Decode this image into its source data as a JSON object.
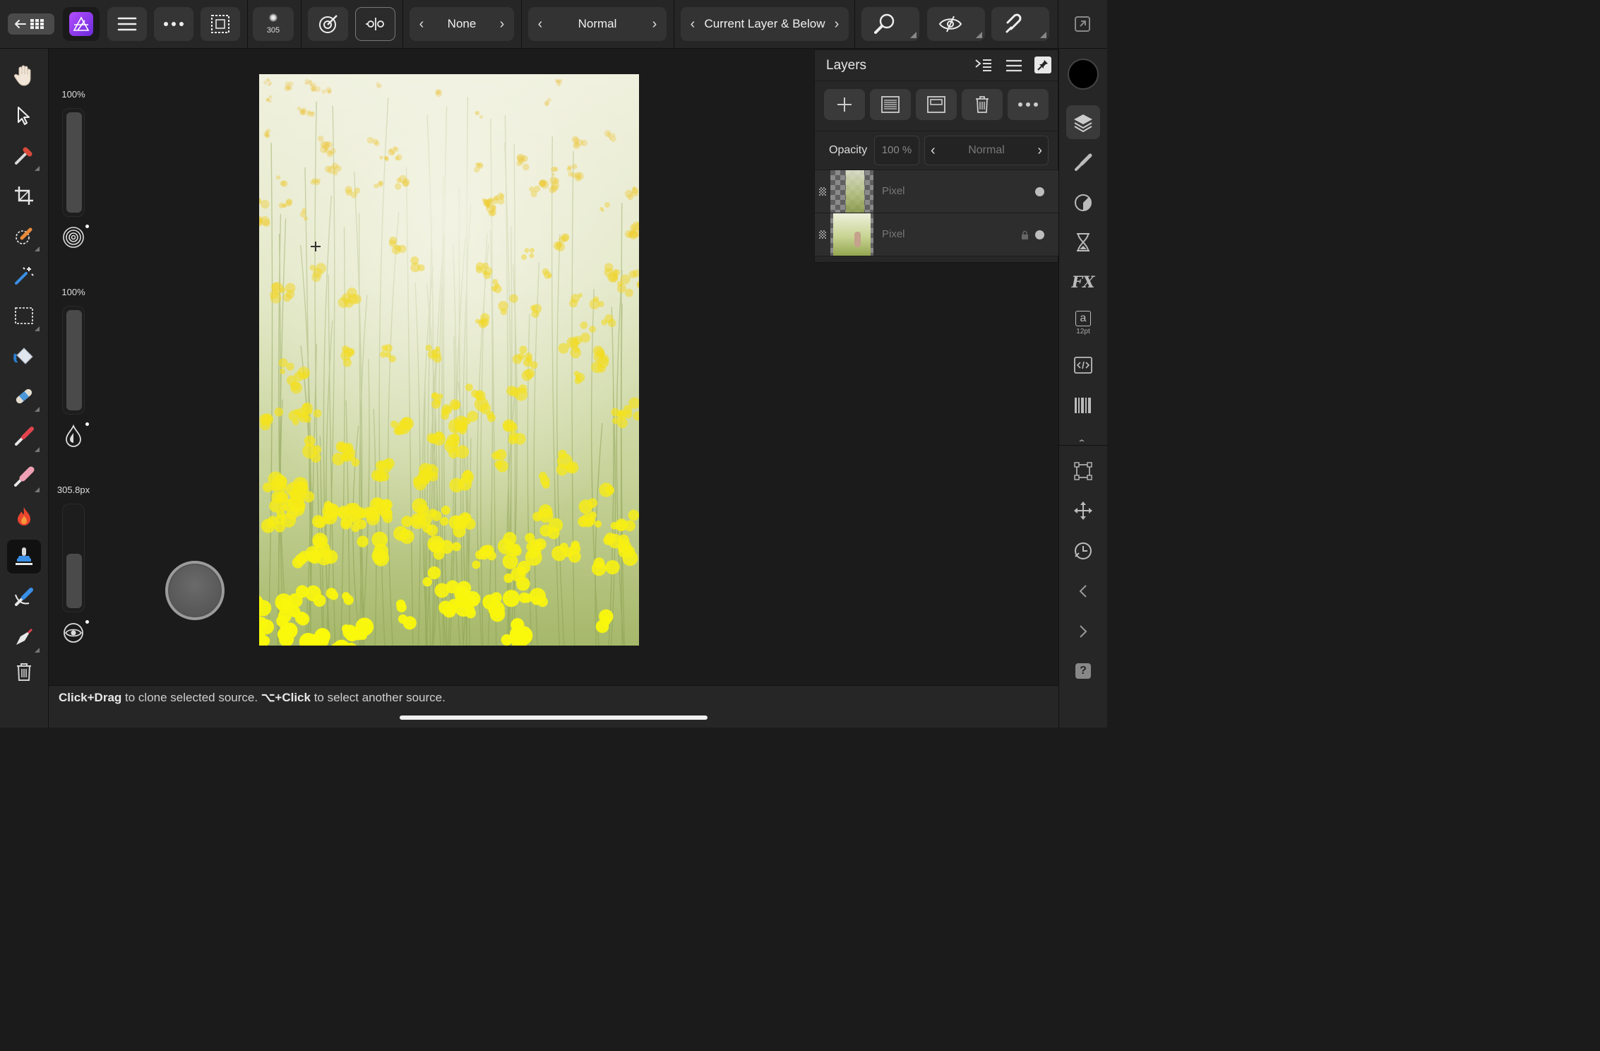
{
  "topbar": {
    "brush_size": "305",
    "stepper_1": "None",
    "stepper_2": "Normal",
    "stepper_3": "Current Layer & Below"
  },
  "context": {
    "opacity_label": "100%",
    "flow_label": "100%",
    "width_label": "305.8px"
  },
  "layers": {
    "title": "Layers",
    "opacity_label": "Opacity",
    "opacity_value": "100 %",
    "blend_mode": "Normal",
    "items": [
      {
        "name": "Pixel"
      },
      {
        "name": "Pixel"
      }
    ]
  },
  "studio": {
    "text_size": "12pt"
  },
  "status": {
    "b1": "Click+Drag",
    "t1": " to clone selected source. ",
    "b2": "⌥+Click",
    "t2": " to select another source."
  },
  "colors": {
    "accent_purple": "#7c3aed",
    "toolbar_bg": "#262626",
    "canvas_bg": "#1b1b1b"
  }
}
